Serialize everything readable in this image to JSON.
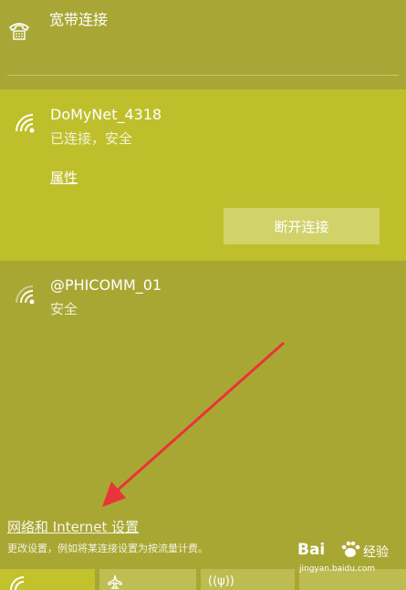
{
  "dialup": {
    "icon": "dialup-phone-icon",
    "label": "宽带连接"
  },
  "connected_network": {
    "icon": "wifi-signal-icon",
    "name": "DoMyNet_4318",
    "status": "已连接，安全",
    "properties_link": "属性",
    "disconnect_button": "断开连接"
  },
  "other_network": {
    "icon": "wifi-signal-icon",
    "name": "@PHICOMM_01",
    "status": "安全"
  },
  "settings": {
    "link": "网络和 Internet 设置",
    "description": "更改设置，例如将某连接设置为按流量计费。"
  },
  "quick_tiles": [
    {
      "icon": "wifi-icon",
      "text": ""
    },
    {
      "icon": "airplane-mode-icon",
      "text": ""
    },
    {
      "icon": "mobile-hotspot-icon",
      "text": "((ψ))"
    }
  ],
  "watermark": {
    "brand": "Bai",
    "suffix": "经验",
    "url": "jingyan.baidu.com"
  },
  "colors": {
    "panel_bg": "#a9a733",
    "connected_bg": "#bfbf2b",
    "arrow": "#e8343a"
  }
}
